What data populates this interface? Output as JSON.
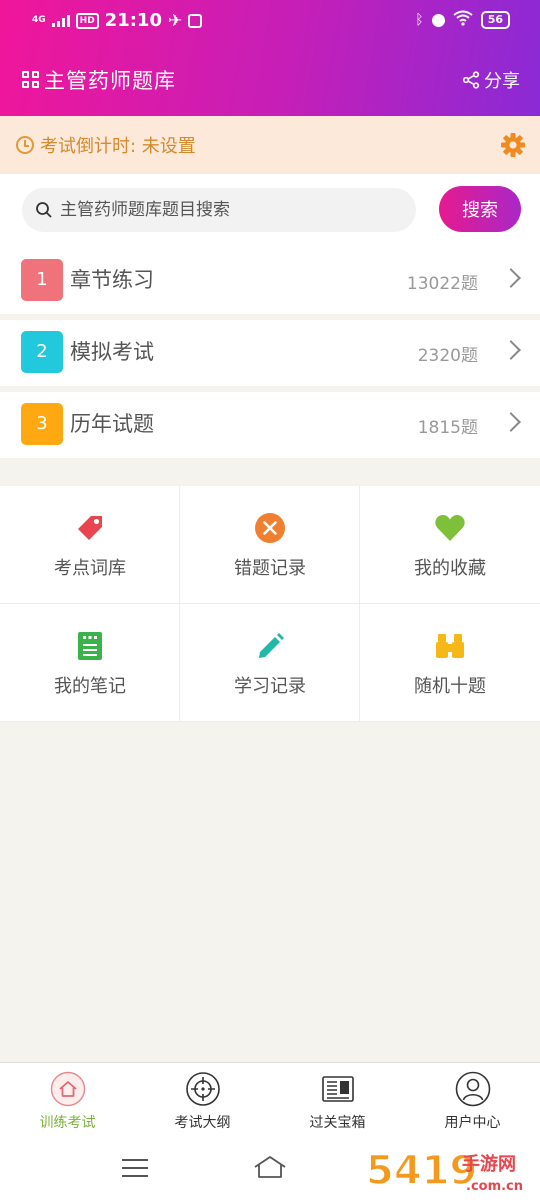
{
  "status_bar": {
    "network": "4G",
    "hd": "HD",
    "time": "21:10",
    "battery": "56"
  },
  "header": {
    "title": "主管药师题库",
    "share_label": "分享"
  },
  "countdown": {
    "text": "考试倒计时: 未设置"
  },
  "search": {
    "placeholder": "主管药师题库题目搜索",
    "button_label": "搜索"
  },
  "practice_items": [
    {
      "num": "1",
      "label": "章节练习",
      "count": "13022题",
      "color": "#f0737c"
    },
    {
      "num": "2",
      "label": "模拟考试",
      "count": "2320题",
      "color": "#22c8dc"
    },
    {
      "num": "3",
      "label": "历年试题",
      "count": "1815题",
      "color": "#ffa812"
    }
  ],
  "features": [
    {
      "label": "考点词库",
      "icon": "tag-icon",
      "color": "#e8454e"
    },
    {
      "label": "错题记录",
      "icon": "close-circle-icon",
      "color": "#f08030"
    },
    {
      "label": "我的收藏",
      "icon": "heart-icon",
      "color": "#7ec03a"
    },
    {
      "label": "我的笔记",
      "icon": "notebook-icon",
      "color": "#3bb24a"
    },
    {
      "label": "学习记录",
      "icon": "pencil-icon",
      "color": "#22b8a8"
    },
    {
      "label": "随机十题",
      "icon": "binoculars-icon",
      "color": "#f6b718"
    }
  ],
  "tabs": [
    {
      "label": "训练考试",
      "icon": "home-icon",
      "active": true
    },
    {
      "label": "考试大纲",
      "icon": "target-icon",
      "active": false
    },
    {
      "label": "过关宝箱",
      "icon": "newspaper-icon",
      "active": false
    },
    {
      "label": "用户中心",
      "icon": "user-icon",
      "active": false
    }
  ],
  "watermark": {
    "text": "5419手游网",
    "url_text": ".com.cn"
  },
  "colors": {
    "accent": "#e61a8f",
    "active_tab": "#7cb33a"
  }
}
